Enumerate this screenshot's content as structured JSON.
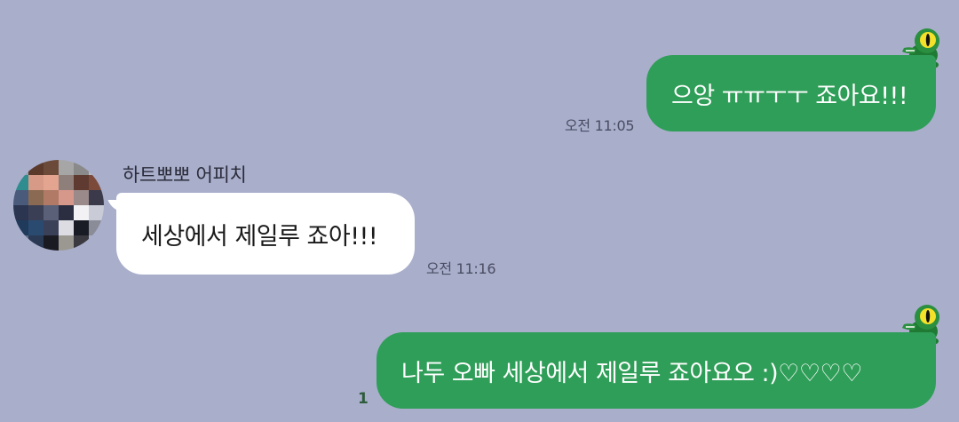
{
  "chat": {
    "background_color": "#a9aecb",
    "outgoing_color": "#2f9e58",
    "incoming_color": "#ffffff",
    "messages": [
      {
        "direction": "outgoing",
        "text": "으앙 ㅠㅠㅜㅜ 죠아요!!!",
        "time": "오전 11:05",
        "sticker_icon": "frog-icon"
      },
      {
        "direction": "incoming",
        "sender": "하트뽀뽀 어피치",
        "avatar_icon": "pixelated-avatar",
        "text": "세상에서 제일루 죠아!!!",
        "time": "오전 11:16"
      },
      {
        "direction": "outgoing",
        "text": "나두 오빠 세상에서 제일루 죠아요오 :)♡♡♡♡",
        "unread_count": "1",
        "sticker_icon": "frog-icon"
      }
    ]
  }
}
